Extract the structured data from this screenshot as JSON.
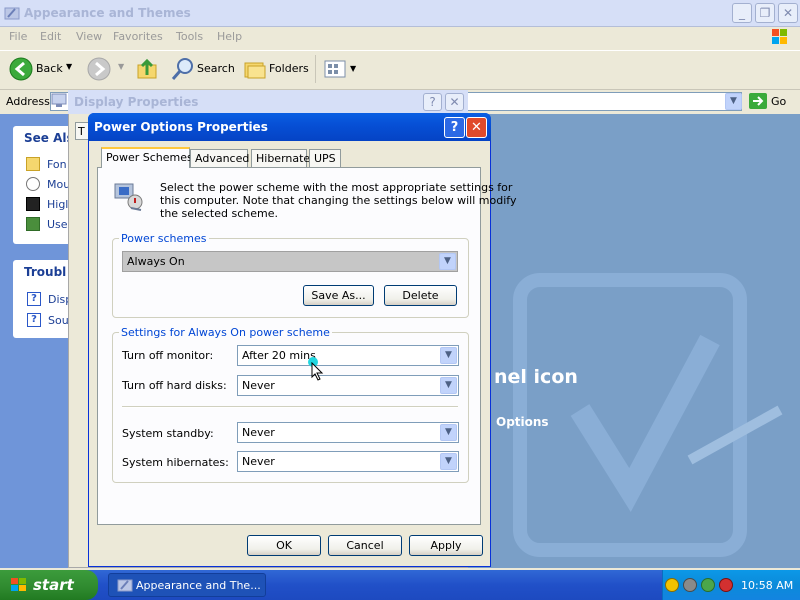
{
  "explorer": {
    "title": "Appearance and Themes",
    "menu": [
      "File",
      "Edit",
      "View",
      "Favorites",
      "Tools",
      "Help"
    ],
    "toolbar": {
      "back_label": "Back",
      "search_label": "Search",
      "folders_label": "Folders"
    },
    "address_label": "Address",
    "go_label": "Go",
    "sidebar": {
      "see_also_title": "See Als",
      "see_also_items": [
        "Fon",
        "Mou",
        "Higl",
        "Use"
      ],
      "trouble_title": "Troubl",
      "trouble_items": [
        "Disp",
        "Sou"
      ]
    },
    "background_text": {
      "icon_label": "nel icon",
      "options_label": "Options"
    }
  },
  "display_properties": {
    "title": "Display Properties",
    "tab_partial": "T"
  },
  "power_options": {
    "title": "Power Options Properties",
    "tabs": [
      "Power Schemes",
      "Advanced",
      "Hibernate",
      "UPS"
    ],
    "active_tab": "Power Schemes",
    "description": [
      "Select the power scheme with the most appropriate settings for",
      "this computer. Note that changing the settings below will modify",
      "the selected scheme."
    ],
    "schemes_group_label": "Power schemes",
    "selected_scheme": "Always On",
    "save_as_label": "Save As...",
    "delete_label": "Delete",
    "settings_group_label": "Settings for Always On power scheme",
    "settings": {
      "monitor_label": "Turn off monitor:",
      "monitor_value": "After 20 mins",
      "hard_disks_label": "Turn off hard disks:",
      "hard_disks_value": "Never",
      "standby_label": "System standby:",
      "standby_value": "Never",
      "hibernates_label": "System hibernates:",
      "hibernates_value": "Never"
    },
    "ok_label": "OK",
    "cancel_label": "Cancel",
    "apply_label": "Apply"
  },
  "taskbar": {
    "start_label": "start",
    "task_label": "Appearance and The...",
    "clock": "10:58 AM"
  },
  "colors": {
    "xp_blue": "#0A5FE3",
    "start_green": "#2F8A2F",
    "group_label_blue": "#0046D5"
  }
}
